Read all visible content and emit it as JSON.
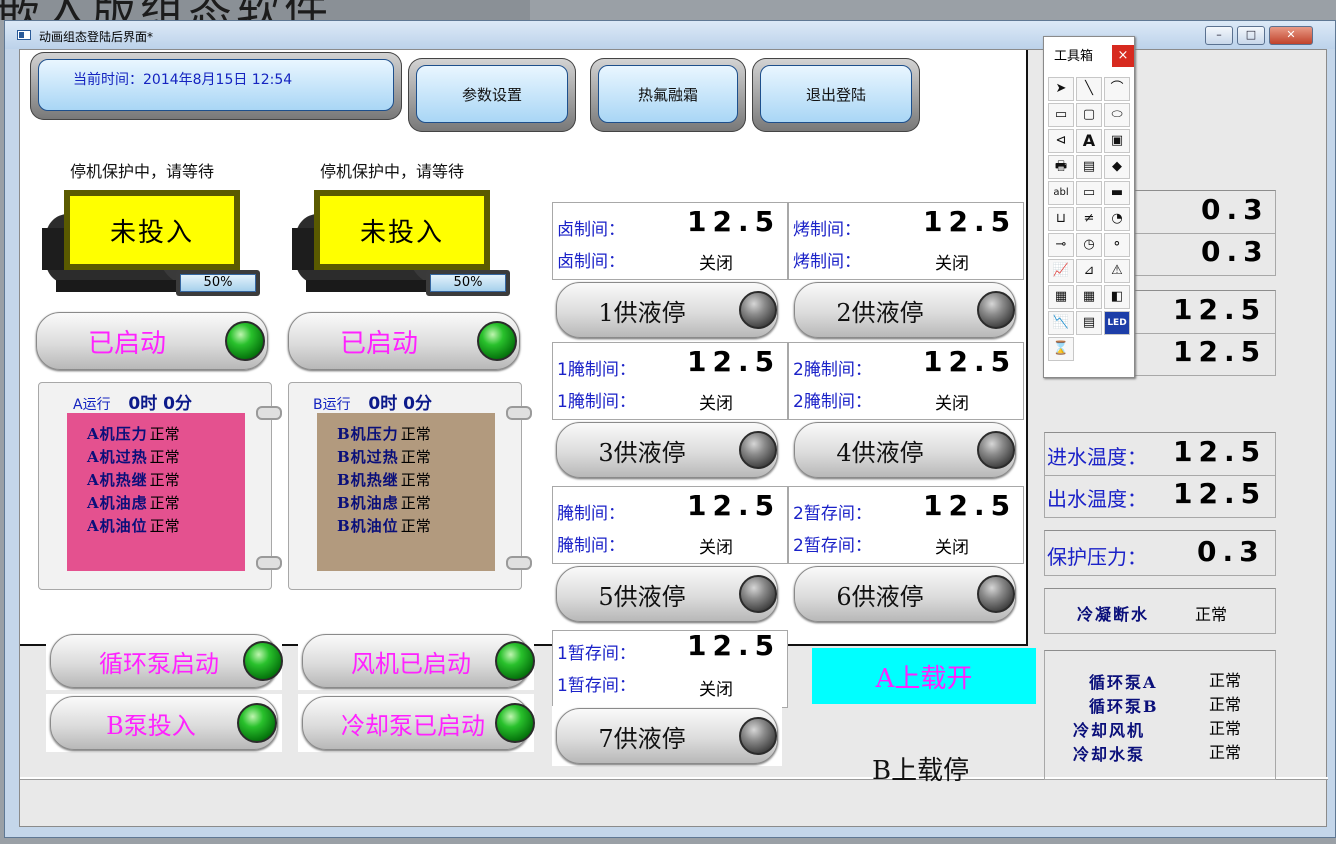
{
  "banner": {
    "text": "嵌入版组态软件"
  },
  "window": {
    "title": "动画组态登陆后界面*",
    "controls": [
      "–",
      "□",
      "✕"
    ]
  },
  "header": {
    "time_label": "当前时间：2014年8月15日 12:54",
    "buttons": [
      "参数设置",
      "热氟融霜",
      "退出登陆"
    ]
  },
  "compressors": [
    {
      "stop_text": "停机保护中，请等待",
      "state": "未投入",
      "percent": "50%",
      "started": "已启动",
      "run_name": "A运行",
      "run_time": "0时 0分",
      "status": [
        {
          "k": "A机压力",
          "v": "正常"
        },
        {
          "k": "A机过热",
          "v": "正常"
        },
        {
          "k": "A机热继",
          "v": "正常"
        },
        {
          "k": "A机油虑",
          "v": "正常"
        },
        {
          "k": "A机油位",
          "v": "正常"
        }
      ]
    },
    {
      "stop_text": "停机保护中，请等待",
      "state": "未投入",
      "percent": "50%",
      "started": "已启动",
      "run_name": "B运行",
      "run_time": "0时 0分",
      "status": [
        {
          "k": "B机压力",
          "v": "正常"
        },
        {
          "k": "B机过热",
          "v": "正常"
        },
        {
          "k": "B机热继",
          "v": "正常"
        },
        {
          "k": "B机油虑",
          "v": "正常"
        },
        {
          "k": "B机油位",
          "v": "正常"
        }
      ]
    }
  ],
  "colors": {
    "panel_a": "#e4518f",
    "panel_b": "#b29a7e",
    "toggle": "#ff22ff",
    "cyan": "#00ffff"
  },
  "pumps": [
    "循环泵启动",
    "风机已启动",
    "B泵投入",
    "冷却泵已启动"
  ],
  "rooms": [
    {
      "name": "卤制间：",
      "value": "12.5",
      "name2": "卤制间：",
      "state": "关闭"
    },
    {
      "name": "烤制间：",
      "value": "12.5",
      "name2": "烤制间：",
      "state": "关闭"
    },
    {
      "name": "1腌制间：",
      "value": "12.5",
      "name2": "1腌制间：",
      "state": "关闭"
    },
    {
      "name": "2腌制间：",
      "value": "12.5",
      "name2": "2腌制间：",
      "state": "关闭"
    },
    {
      "name": "腌制间：",
      "value": "12.5",
      "name2": "腌制间：",
      "state": "关闭"
    },
    {
      "name": "2暂存间：",
      "value": "12.5",
      "name2": "2暂存间：",
      "state": "关闭"
    },
    {
      "name": "1暂存间：",
      "value": "12.5",
      "name2": "1暂存间：",
      "state": "关闭"
    }
  ],
  "supply": [
    "1供液停",
    "2供液停",
    "3供液停",
    "4供液停",
    "5供液停",
    "6供液停",
    "7供液停"
  ],
  "load": {
    "a": "A上载开",
    "b": "B上载停"
  },
  "right": {
    "p1": {
      "label": "：",
      "value": "0.3"
    },
    "p2": {
      "label": "：",
      "value": "0.3"
    },
    "t1": {
      "label": "：",
      "value": "12.5"
    },
    "t2": {
      "label": "：",
      "value": "12.5"
    },
    "in_water": {
      "label": "进水温度：",
      "value": "12.5"
    },
    "out_water": {
      "label": "出水温度：",
      "value": "12.5"
    },
    "protect": {
      "label": "保护压力：",
      "value": "0.3"
    },
    "cond": {
      "label": "冷凝断水",
      "value": "正常"
    },
    "list": [
      {
        "k": "循环泵A",
        "v": "正常"
      },
      {
        "k": "循环泵B",
        "v": "正常"
      },
      {
        "k": "冷却风机",
        "v": "正常"
      },
      {
        "k": "冷却水泵",
        "v": "正常"
      }
    ]
  },
  "toolbox": {
    "title": "工具箱",
    "close": "×",
    "tools": [
      "➤",
      "╲",
      "⌒",
      "▭",
      "▢",
      "⬭",
      "⊲",
      "A",
      "▣",
      "🖶",
      "▤",
      "◆",
      "abl",
      "▭",
      "▬",
      "⊔",
      "≠",
      "◔",
      "⊸",
      "◷",
      "⚬",
      "📈",
      "⊿",
      "⚠",
      "▦",
      "▦",
      "◧",
      "📉",
      "▤",
      "LED",
      "⌛"
    ]
  }
}
